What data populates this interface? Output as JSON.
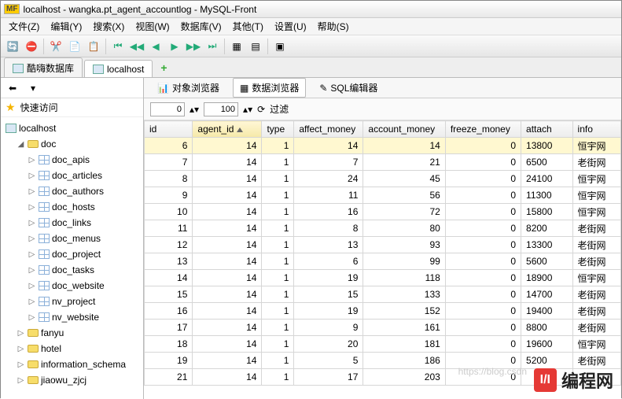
{
  "window": {
    "title": "localhost - wangka.pt_agent_accountlog - MySQL-Front"
  },
  "menu": [
    "文件(Z)",
    "编辑(Y)",
    "搜索(X)",
    "视图(W)",
    "数据库(V)",
    "其他(T)",
    "设置(U)",
    "帮助(S)"
  ],
  "tabs": [
    {
      "label": "酷嗨数据库",
      "active": false
    },
    {
      "label": "localhost",
      "active": true
    }
  ],
  "quick_access": {
    "label": "快速访问"
  },
  "tree": {
    "host": "localhost",
    "databases": [
      {
        "name": "doc",
        "expanded": true,
        "tables": [
          "doc_apis",
          "doc_articles",
          "doc_authors",
          "doc_hosts",
          "doc_links",
          "doc_menus",
          "doc_project",
          "doc_tasks",
          "doc_website",
          "nv_project",
          "nv_website"
        ]
      },
      {
        "name": "fanyu",
        "expanded": false
      },
      {
        "name": "hotel",
        "expanded": false
      },
      {
        "name": "information_schema",
        "expanded": false
      },
      {
        "name": "jiaowu_zjcj",
        "expanded": false
      }
    ]
  },
  "subtabs": {
    "object_browser": "对象浏览器",
    "data_browser": "数据浏览器",
    "sql_editor": "SQL编辑器"
  },
  "filter": {
    "from": "0",
    "limit": "100",
    "label": "过滤"
  },
  "columns": [
    "id",
    "agent_id",
    "type",
    "affect_money",
    "account_money",
    "freeze_money",
    "attach",
    "info"
  ],
  "sort_col": "agent_id",
  "rows": [
    {
      "id": 6,
      "agent_id": 14,
      "type": 1,
      "affect_money": 14,
      "account_money": 14,
      "freeze_money": 0,
      "attach": "13800",
      "info": "恒宇网"
    },
    {
      "id": 7,
      "agent_id": 14,
      "type": 1,
      "affect_money": 7,
      "account_money": 21,
      "freeze_money": 0,
      "attach": "6500",
      "info": "老街网"
    },
    {
      "id": 8,
      "agent_id": 14,
      "type": 1,
      "affect_money": 24,
      "account_money": 45,
      "freeze_money": 0,
      "attach": "24100",
      "info": "恒宇网"
    },
    {
      "id": 9,
      "agent_id": 14,
      "type": 1,
      "affect_money": 11,
      "account_money": 56,
      "freeze_money": 0,
      "attach": "11300",
      "info": "恒宇网"
    },
    {
      "id": 10,
      "agent_id": 14,
      "type": 1,
      "affect_money": 16,
      "account_money": 72,
      "freeze_money": 0,
      "attach": "15800",
      "info": "恒宇网"
    },
    {
      "id": 11,
      "agent_id": 14,
      "type": 1,
      "affect_money": 8,
      "account_money": 80,
      "freeze_money": 0,
      "attach": "8200",
      "info": "老街网"
    },
    {
      "id": 12,
      "agent_id": 14,
      "type": 1,
      "affect_money": 13,
      "account_money": 93,
      "freeze_money": 0,
      "attach": "13300",
      "info": "老街网"
    },
    {
      "id": 13,
      "agent_id": 14,
      "type": 1,
      "affect_money": 6,
      "account_money": 99,
      "freeze_money": 0,
      "attach": "5600",
      "info": "老街网"
    },
    {
      "id": 14,
      "agent_id": 14,
      "type": 1,
      "affect_money": 19,
      "account_money": 118,
      "freeze_money": 0,
      "attach": "18900",
      "info": "恒宇网"
    },
    {
      "id": 15,
      "agent_id": 14,
      "type": 1,
      "affect_money": 15,
      "account_money": 133,
      "freeze_money": 0,
      "attach": "14700",
      "info": "老街网"
    },
    {
      "id": 16,
      "agent_id": 14,
      "type": 1,
      "affect_money": 19,
      "account_money": 152,
      "freeze_money": 0,
      "attach": "19400",
      "info": "老街网"
    },
    {
      "id": 17,
      "agent_id": 14,
      "type": 1,
      "affect_money": 9,
      "account_money": 161,
      "freeze_money": 0,
      "attach": "8800",
      "info": "老街网"
    },
    {
      "id": 18,
      "agent_id": 14,
      "type": 1,
      "affect_money": 20,
      "account_money": 181,
      "freeze_money": 0,
      "attach": "19600",
      "info": "恒宇网"
    },
    {
      "id": 19,
      "agent_id": 14,
      "type": 1,
      "affect_money": 5,
      "account_money": 186,
      "freeze_money": 0,
      "attach": "5200",
      "info": "老街网"
    },
    {
      "id": 21,
      "agent_id": 14,
      "type": 1,
      "affect_money": 17,
      "account_money": 203,
      "freeze_money": 0,
      "attach": "",
      "info": ""
    }
  ],
  "selected_row": 0,
  "ghost_url": "https://blog.csdn",
  "watermark": {
    "badge": "I/I",
    "text": "编程网"
  }
}
